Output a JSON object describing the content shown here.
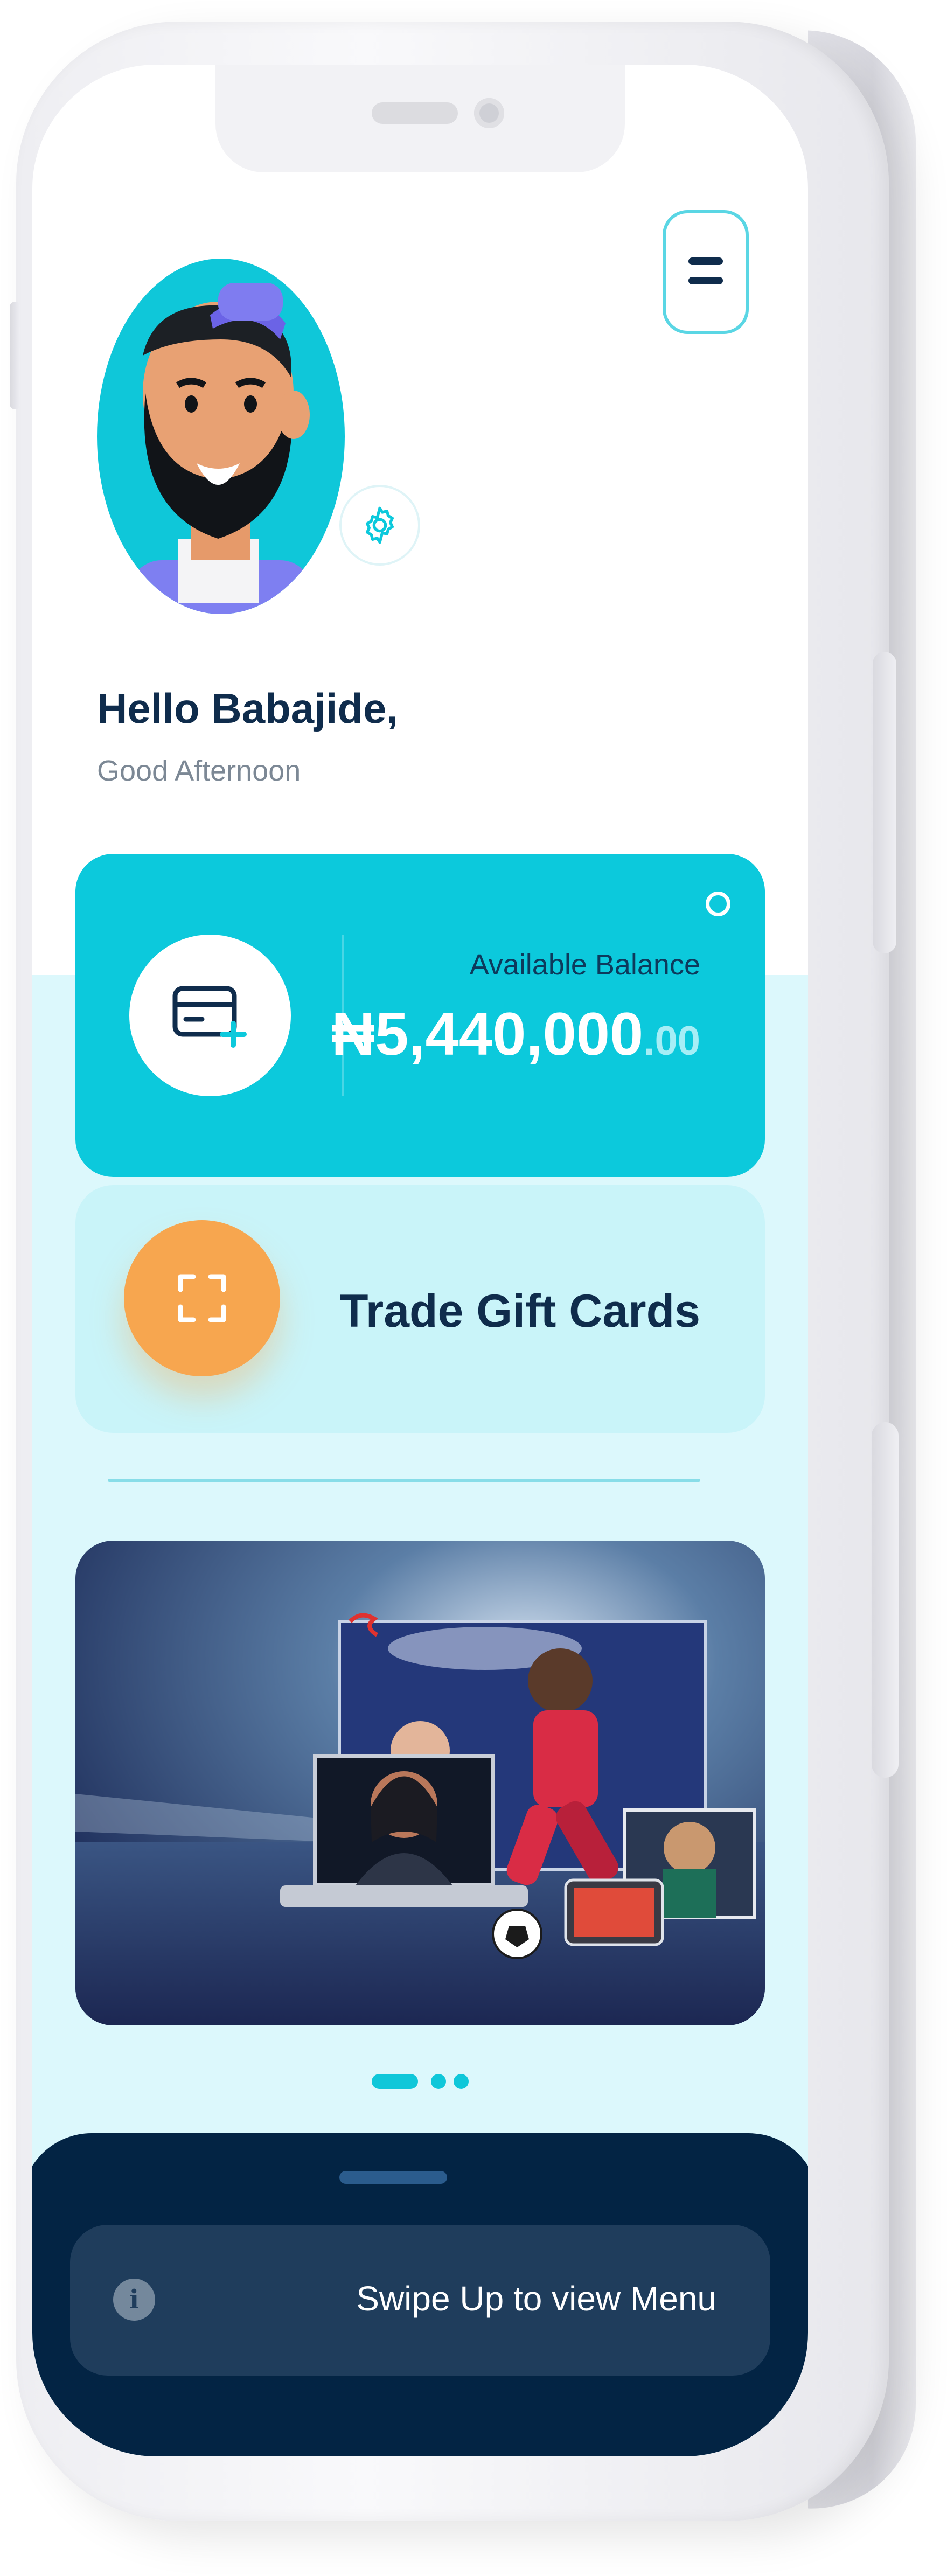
{
  "colors": {
    "accent": "#0cc9dc",
    "navy": "#0f2c4c",
    "trade_card": "#c9f4f9",
    "scan_button": "#f7a64f",
    "bottom_sheet": "#032444"
  },
  "header": {
    "menu_icon": "hamburger-icon",
    "settings_icon": "gear-icon",
    "avatar": "avatar-illustration"
  },
  "greeting": {
    "title": "Hello Babajide,",
    "subtitle": "Good Afternoon"
  },
  "balance_card": {
    "icon": "wallet-add-icon",
    "label": "Available Balance",
    "amount": "₦5,440,000",
    "decimals": ".00"
  },
  "trade_card": {
    "icon": "scan-frame-icon",
    "label": "Trade Gift Cards"
  },
  "carousel": {
    "banner": "tv-streaming-banner",
    "active_index": 1,
    "count": 3
  },
  "bottom_sheet": {
    "icon": "info-icon",
    "info_glyph": "i",
    "label": "Swipe Up to view Menu"
  }
}
